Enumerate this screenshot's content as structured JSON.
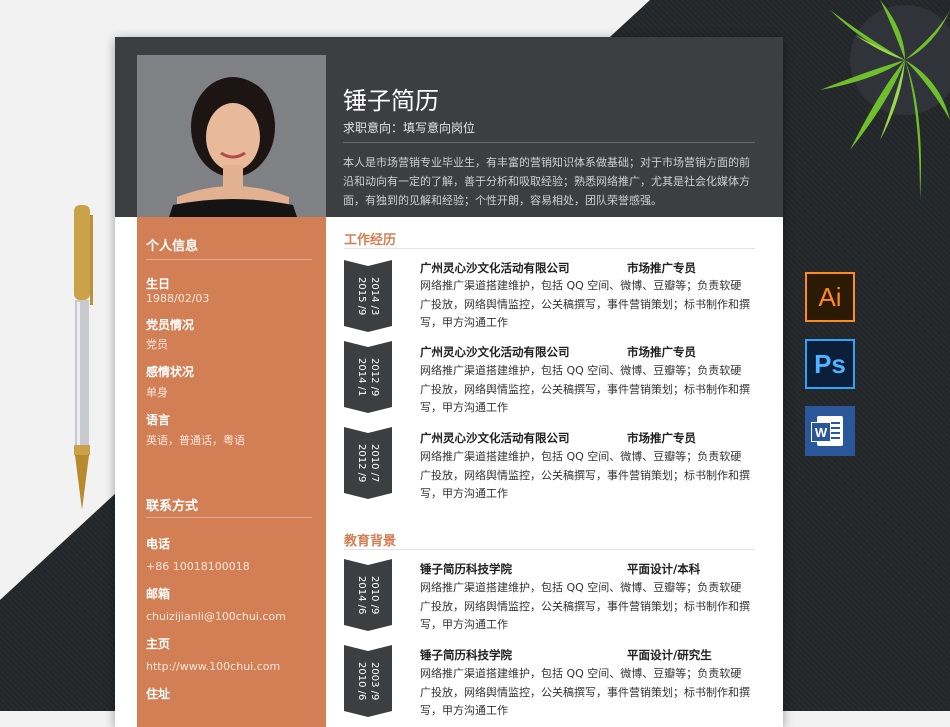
{
  "resume": {
    "name": "锤子简历",
    "intention": "求职意向：填写意向岗位",
    "summary": "本人是市场营销专业毕业生，有丰富的营销知识体系做基础；对于市场营销方面的前沿和动向有一定的了解，善于分析和吸取经验；熟悉网络推广，尤其是社会化媒体方面，有独到的见解和经验；个性开朗，容易相处，团队荣誉感强。"
  },
  "personal": {
    "title": "个人信息",
    "fields": [
      {
        "label": "生日",
        "value": "1988/02/03"
      },
      {
        "label": "党员情况",
        "value": "党员"
      },
      {
        "label": "感情状况",
        "value": "单身"
      },
      {
        "label": "语言",
        "value": "英语，普通话，粤语"
      }
    ]
  },
  "contact": {
    "title": "联系方式",
    "fields": [
      {
        "label": "电话",
        "value": "+86 10018100018"
      },
      {
        "label": "邮箱",
        "value": "chuizijianli@100chui.com"
      },
      {
        "label": "主页",
        "value": "http://www.100chui.com"
      },
      {
        "label": "住址",
        "value": ""
      }
    ]
  },
  "work": {
    "title": "工作经历",
    "entries": [
      {
        "dates": "2014 /3\n2015 /9",
        "org": "广州灵心沙文化活动有限公司",
        "role": "市场推广专员",
        "desc": "网络推广渠道搭建维护，包括 QQ 空间、微博、豆瓣等；负责软硬广投放，网络舆情监控，公关稿撰写，事件营销策划；标书制作和撰写，甲方沟通工作"
      },
      {
        "dates": "2012 /9\n2014 /1",
        "org": "广州灵心沙文化活动有限公司",
        "role": "市场推广专员",
        "desc": "网络推广渠道搭建维护，包括 QQ 空间、微博、豆瓣等；负责软硬广投放，网络舆情监控，公关稿撰写，事件营销策划；标书制作和撰写，甲方沟通工作"
      },
      {
        "dates": "2010 /7\n2012 /9",
        "org": "广州灵心沙文化活动有限公司",
        "role": "市场推广专员",
        "desc": "网络推广渠道搭建维护，包括 QQ 空间、微博、豆瓣等；负责软硬广投放，网络舆情监控，公关稿撰写，事件营销策划；标书制作和撰写，甲方沟通工作"
      }
    ]
  },
  "education": {
    "title": "教育背景",
    "entries": [
      {
        "dates": "2010 /9\n2014 /6",
        "org": "锤子简历科技学院",
        "role": "平面设计/本科",
        "desc": "网络推广渠道搭建维护，包括 QQ 空间、微博、豆瓣等；负责软硬广投放，网络舆情监控，公关稿撰写，事件营销策划；标书制作和撰写，甲方沟通工作"
      },
      {
        "dates": "2003 /9\n2010 /6",
        "org": "锤子简历科技学院",
        "role": "平面设计/研究生",
        "desc": "网络推广渠道搭建维护，包括 QQ 空间、微博、豆瓣等；负责软硬广投放，网络舆情监控，公关稿撰写，事件营销策划；标书制作和撰写，甲方沟通工作"
      }
    ]
  },
  "apps": {
    "illustrator": "Ai",
    "photoshop": "Ps",
    "word": "W"
  },
  "colors": {
    "accent": "#d27f56",
    "header": "#3d3e40",
    "tag": "#3d3e40"
  }
}
